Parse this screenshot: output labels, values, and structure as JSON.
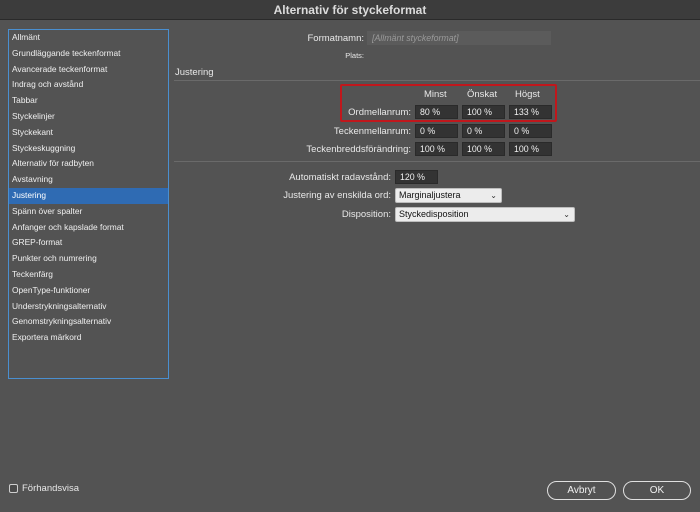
{
  "window": {
    "title": "Alternativ för styckeformat"
  },
  "sidebar": {
    "items": [
      "Allmänt",
      "Grundläggande teckenformat",
      "Avancerade teckenformat",
      "Indrag och avstånd",
      "Tabbar",
      "Styckelinjer",
      "Styckekant",
      "Styckeskuggning",
      "Alternativ för radbyten",
      "Avstavning",
      "Justering",
      "Spänn över spalter",
      "Anfanger och kapslade format",
      "GREP-format",
      "Punkter och numrering",
      "Teckenfärg",
      "OpenType-funktioner",
      "Understrykningsalternativ",
      "Genomstrykningsalternativ",
      "Exportera märkord"
    ],
    "selected": "Justering"
  },
  "header": {
    "formatname_label": "Formatnamn:",
    "formatname_value": "[Allmänt styckeformat]",
    "location_label": "Plats:"
  },
  "section": {
    "title": "Justering"
  },
  "spacing": {
    "col_min": "Minst",
    "col_desired": "Önskat",
    "col_max": "Högst",
    "rows": [
      {
        "label": "Ordmellanrum:",
        "min": "80 %",
        "desired": "100 %",
        "max": "133 %"
      },
      {
        "label": "Teckenmellanrum:",
        "min": "0 %",
        "desired": "0 %",
        "max": "0 %"
      },
      {
        "label": "Teckenbreddsförändring:",
        "min": "100 %",
        "desired": "100 %",
        "max": "100 %"
      }
    ]
  },
  "autoleading": {
    "label": "Automatiskt radavstånd:",
    "value": "120 %"
  },
  "single_word": {
    "label": "Justering av enskilda ord:",
    "value": "Marginaljustera"
  },
  "composer": {
    "label": "Disposition:",
    "value": "Styckedisposition"
  },
  "preview": {
    "label": "Förhandsvisa",
    "checked": false
  },
  "buttons": {
    "cancel": "Avbryt",
    "ok": "OK"
  },
  "colors": {
    "highlight": "#c0171c",
    "selection": "#2f6bb3",
    "background": "#535353"
  }
}
